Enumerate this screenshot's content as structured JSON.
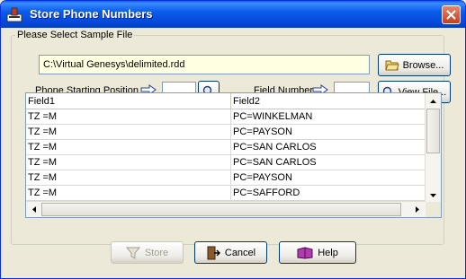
{
  "window": {
    "title": "Store Phone Numbers"
  },
  "group": {
    "legend": "Please Select Sample File"
  },
  "file": {
    "path": "C:\\Virtual Genesys\\delimited.rdd"
  },
  "buttons": {
    "browse": "Browse...",
    "view_file": "View File...",
    "store": "Store",
    "cancel": "Cancel",
    "help": "Help"
  },
  "fields": {
    "phone_start_label": "Phone Starting Position",
    "phone_start_value": "",
    "field_number_label": "Field Number",
    "field_number_value": ""
  },
  "grid": {
    "columns": [
      "Field1",
      "Field2"
    ],
    "rows": [
      [
        "TZ =M",
        "PC=WINKELMAN"
      ],
      [
        "TZ =M",
        "PC=PAYSON"
      ],
      [
        "TZ =M",
        "PC=SAN CARLOS"
      ],
      [
        "TZ =M",
        "PC=SAN CARLOS"
      ],
      [
        "TZ =M",
        "PC=PAYSON"
      ],
      [
        "TZ =M",
        "PC=SAFFORD"
      ]
    ]
  },
  "colors": {
    "titlebar": "#0A5BE8",
    "dialog_bg": "#ECE9D8",
    "path_bg": "#FFFFE1"
  }
}
